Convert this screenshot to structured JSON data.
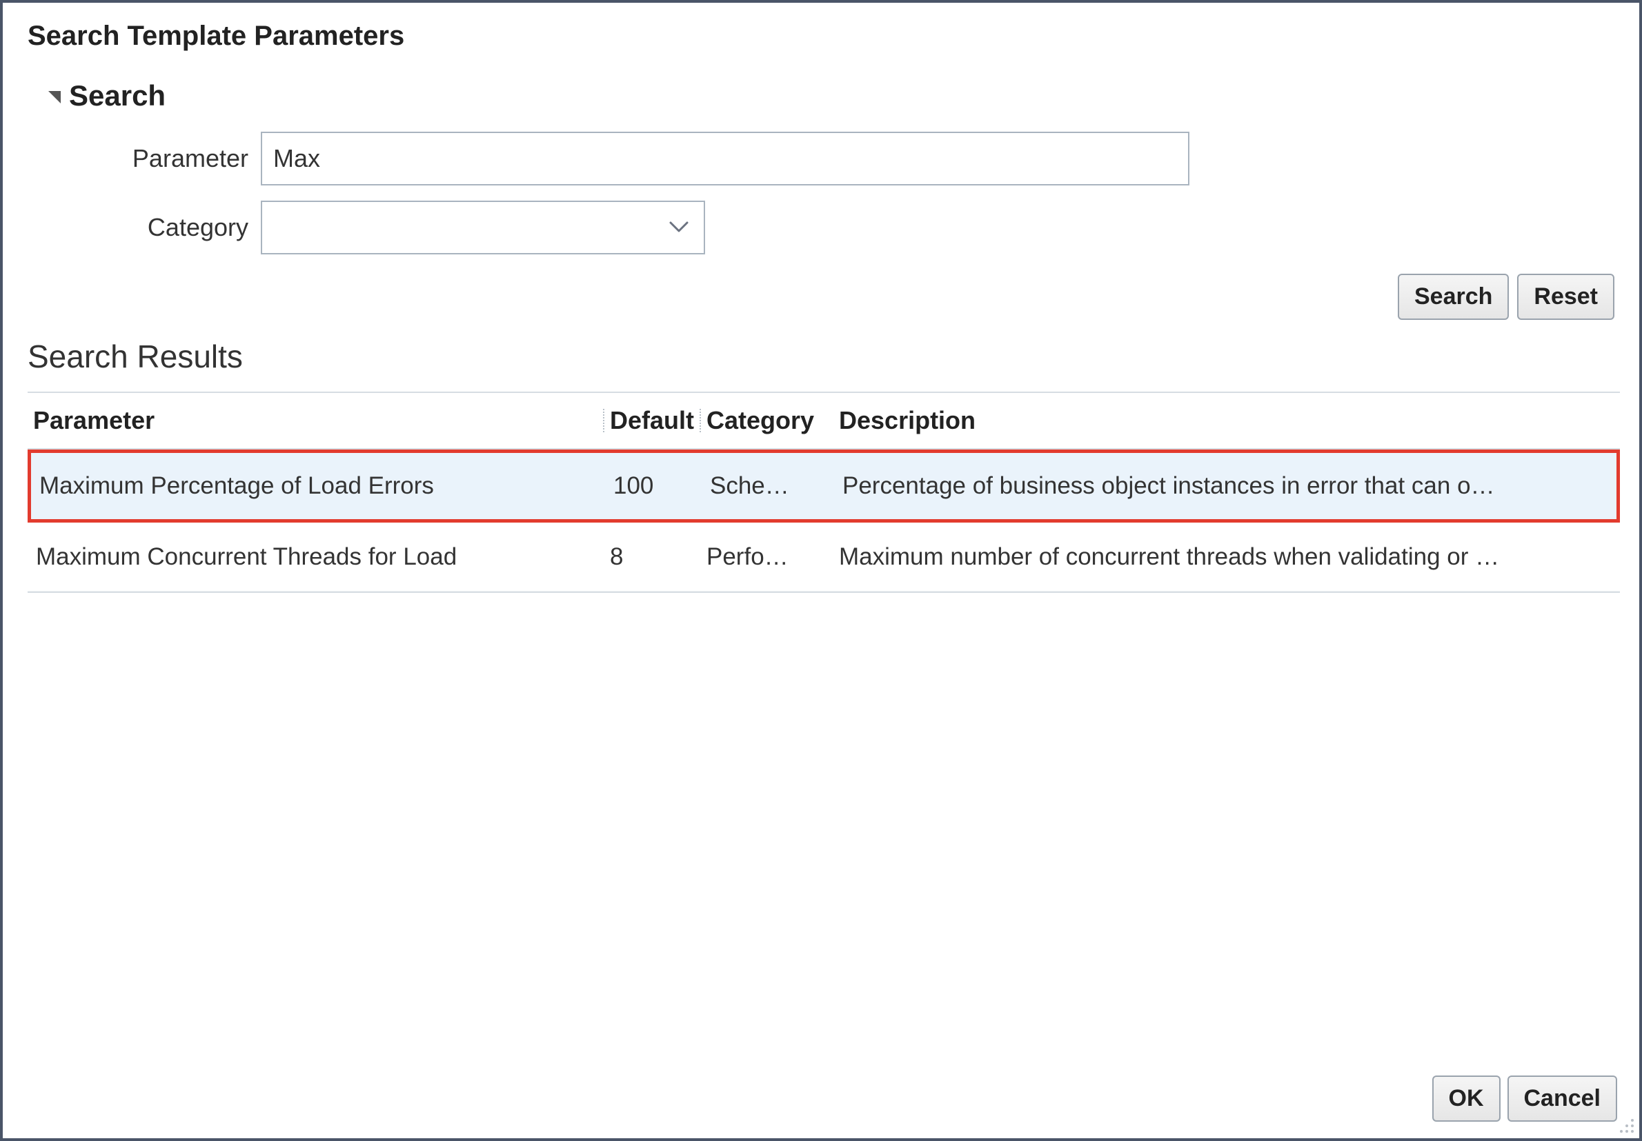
{
  "dialog": {
    "title": "Search Template Parameters"
  },
  "search": {
    "section_label": "Search",
    "parameter_label": "Parameter",
    "parameter_value": "Max",
    "category_label": "Category",
    "category_value": "",
    "buttons": {
      "search": "Search",
      "reset": "Reset"
    }
  },
  "results": {
    "title": "Search Results",
    "columns": {
      "parameter": "Parameter",
      "default": "Default",
      "category": "Category",
      "description": "Description"
    },
    "rows": [
      {
        "parameter": "Maximum Percentage of Load Errors",
        "default": "100",
        "category": "Sche…",
        "description": "Percentage of business object instances in error that can o…",
        "highlighted": true
      },
      {
        "parameter": "Maximum Concurrent Threads for Load",
        "default": "8",
        "category": "Perfo…",
        "description": "Maximum number of concurrent threads when validating or …",
        "highlighted": false
      }
    ]
  },
  "footer": {
    "ok": "OK",
    "cancel": "Cancel"
  }
}
